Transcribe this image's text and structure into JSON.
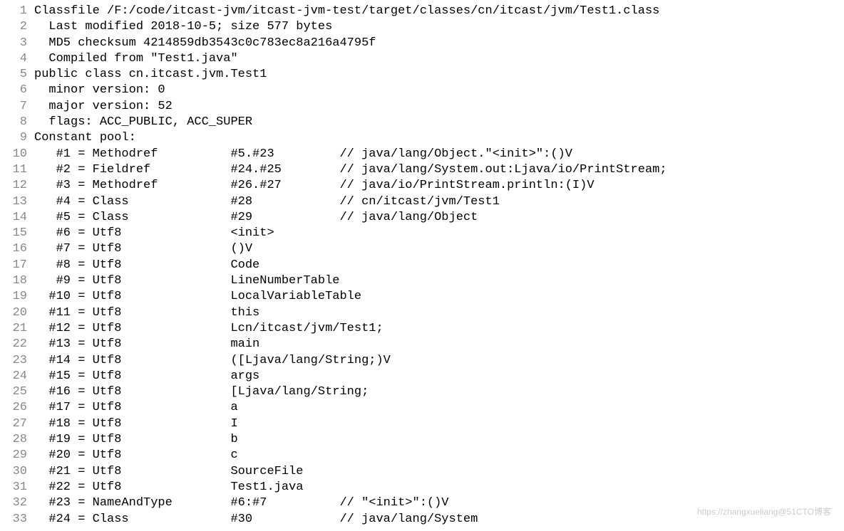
{
  "lines": [
    {
      "num": "1",
      "text": "Classfile /F:/code/itcast-jvm/itcast-jvm-test/target/classes/cn/itcast/jvm/Test1.class"
    },
    {
      "num": "2",
      "text": "  Last modified 2018-10-5; size 577 bytes"
    },
    {
      "num": "3",
      "text": "  MD5 checksum 4214859db3543c0c783ec8a216a4795f"
    },
    {
      "num": "4",
      "text": "  Compiled from \"Test1.java\""
    },
    {
      "num": "5",
      "text": "public class cn.itcast.jvm.Test1"
    },
    {
      "num": "6",
      "text": "  minor version: 0"
    },
    {
      "num": "7",
      "text": "  major version: 52"
    },
    {
      "num": "8",
      "text": "  flags: ACC_PUBLIC, ACC_SUPER"
    },
    {
      "num": "9",
      "text": "Constant pool:"
    },
    {
      "num": "10",
      "text": "   #1 = Methodref          #5.#23         // java/lang/Object.\"<init>\":()V"
    },
    {
      "num": "11",
      "text": "   #2 = Fieldref           #24.#25        // java/lang/System.out:Ljava/io/PrintStream;"
    },
    {
      "num": "12",
      "text": "   #3 = Methodref          #26.#27        // java/io/PrintStream.println:(I)V"
    },
    {
      "num": "13",
      "text": "   #4 = Class              #28            // cn/itcast/jvm/Test1"
    },
    {
      "num": "14",
      "text": "   #5 = Class              #29            // java/lang/Object"
    },
    {
      "num": "15",
      "text": "   #6 = Utf8               <init>"
    },
    {
      "num": "16",
      "text": "   #7 = Utf8               ()V"
    },
    {
      "num": "17",
      "text": "   #8 = Utf8               Code"
    },
    {
      "num": "18",
      "text": "   #9 = Utf8               LineNumberTable"
    },
    {
      "num": "19",
      "text": "  #10 = Utf8               LocalVariableTable"
    },
    {
      "num": "20",
      "text": "  #11 = Utf8               this"
    },
    {
      "num": "21",
      "text": "  #12 = Utf8               Lcn/itcast/jvm/Test1;"
    },
    {
      "num": "22",
      "text": "  #13 = Utf8               main"
    },
    {
      "num": "23",
      "text": "  #14 = Utf8               ([Ljava/lang/String;)V"
    },
    {
      "num": "24",
      "text": "  #15 = Utf8               args"
    },
    {
      "num": "25",
      "text": "  #16 = Utf8               [Ljava/lang/String;"
    },
    {
      "num": "26",
      "text": "  #17 = Utf8               a"
    },
    {
      "num": "27",
      "text": "  #18 = Utf8               I"
    },
    {
      "num": "28",
      "text": "  #19 = Utf8               b"
    },
    {
      "num": "29",
      "text": "  #20 = Utf8               c"
    },
    {
      "num": "30",
      "text": "  #21 = Utf8               SourceFile"
    },
    {
      "num": "31",
      "text": "  #22 = Utf8               Test1.java"
    },
    {
      "num": "32",
      "text": "  #23 = NameAndType        #6:#7          // \"<init>\":()V"
    },
    {
      "num": "33",
      "text": "  #24 = Class              #30            // java/lang/System"
    }
  ],
  "marker_line": "24",
  "cursor_line": "8",
  "watermark": "https://zhangxueliang@51CTO博客"
}
